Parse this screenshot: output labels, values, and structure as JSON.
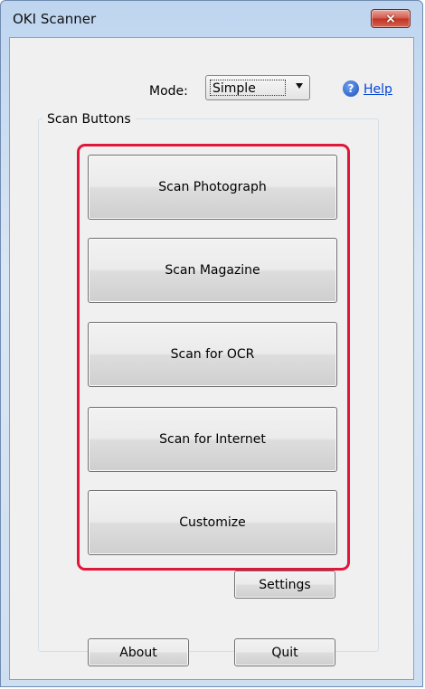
{
  "window": {
    "title": "OKI Scanner",
    "close_glyph": "×"
  },
  "mode": {
    "label": "Mode:",
    "selected": "Simple"
  },
  "help": {
    "icon_glyph": "?",
    "label": "Help"
  },
  "scan_group": {
    "title": "Scan Buttons",
    "buttons": [
      {
        "label": "Scan Photograph"
      },
      {
        "label": "Scan Magazine"
      },
      {
        "label": "Scan for OCR"
      },
      {
        "label": "Scan for Internet"
      },
      {
        "label": "Customize"
      }
    ],
    "highlight_color": "#e0173a"
  },
  "settings_label": "Settings",
  "footer": {
    "about_label": "About",
    "quit_label": "Quit"
  }
}
